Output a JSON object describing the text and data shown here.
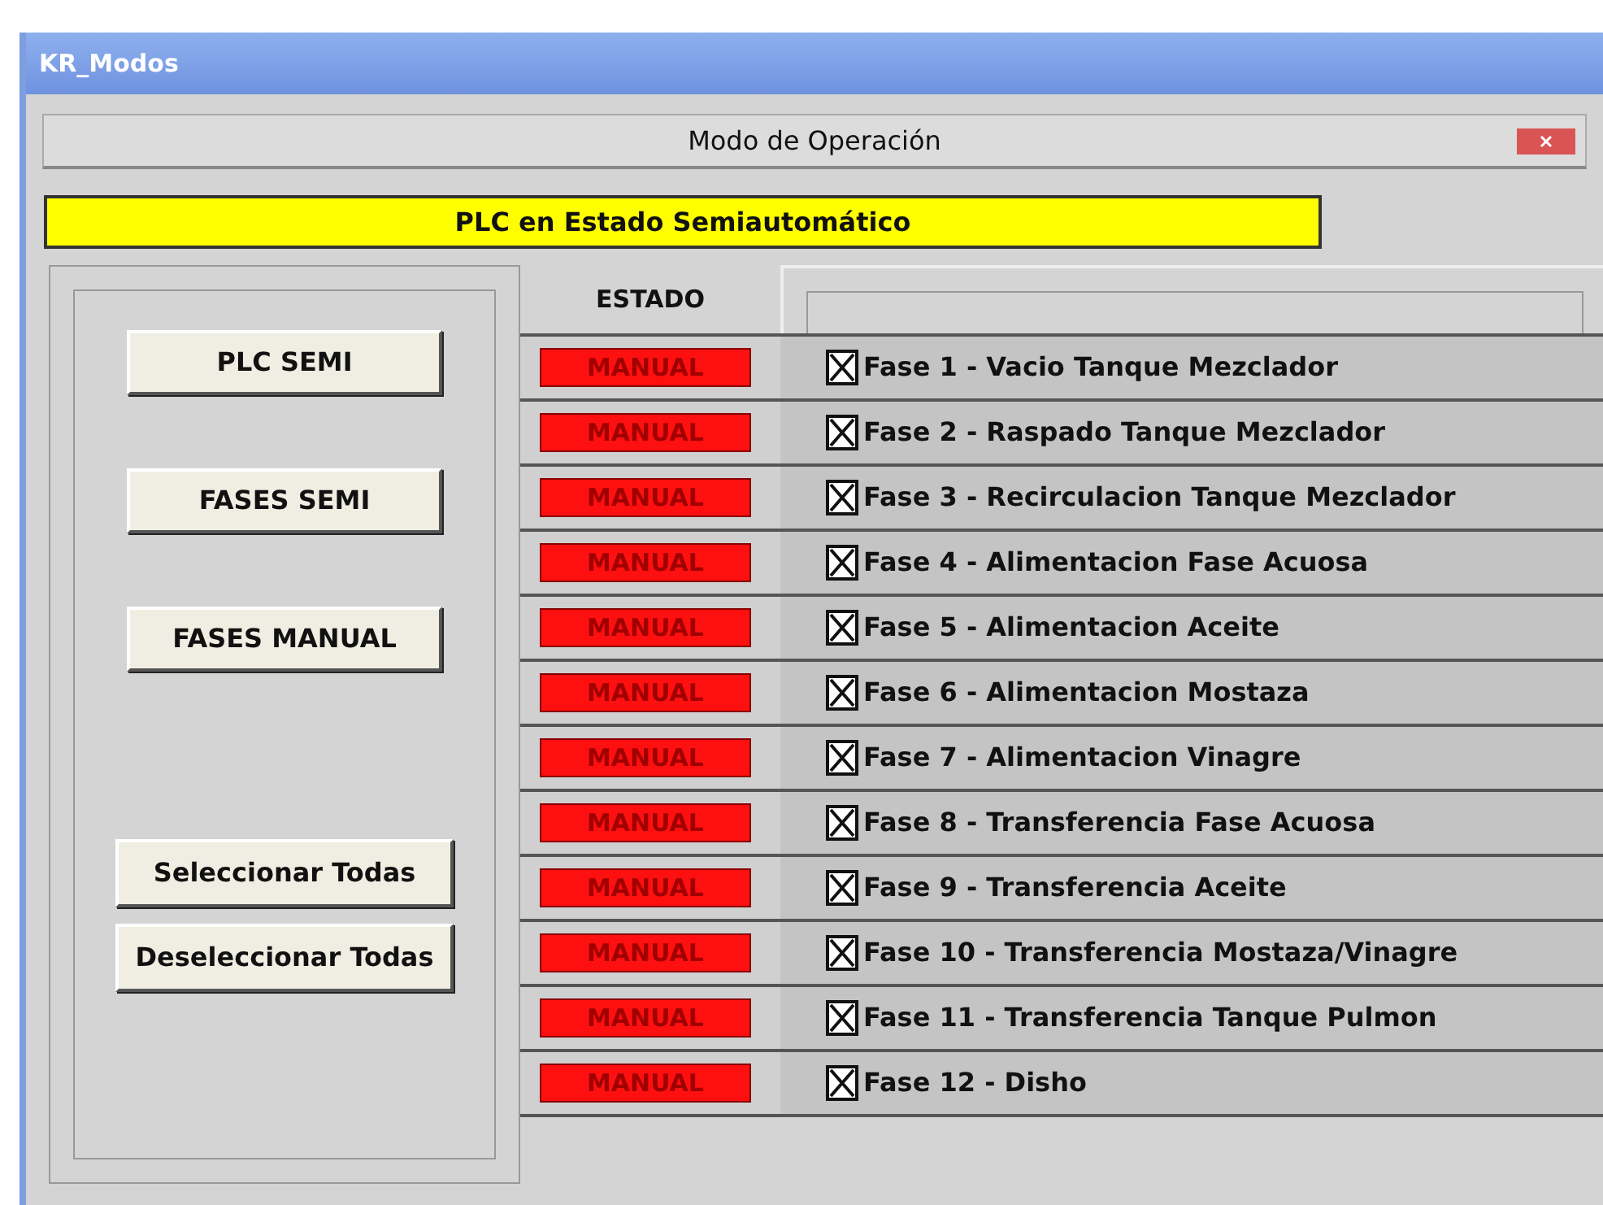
{
  "window": {
    "title": "KR_Modos"
  },
  "dialog": {
    "title": "Modo de Operación"
  },
  "status_banner": "PLC en Estado Semiautomático",
  "mode_buttons": [
    "PLC SEMI",
    "FASES SEMI",
    "FASES MANUAL"
  ],
  "selection_buttons": [
    "Seleccionar Todas",
    "Deseleccionar Todas"
  ],
  "table": {
    "status_header": "ESTADO",
    "rows": [
      {
        "status": "MANUAL",
        "checked": true,
        "phase": "Fase 1 - Vacio Tanque Mezclador"
      },
      {
        "status": "MANUAL",
        "checked": true,
        "phase": "Fase 2 - Raspado Tanque Mezclador"
      },
      {
        "status": "MANUAL",
        "checked": true,
        "phase": "Fase 3 - Recirculacion Tanque Mezclador"
      },
      {
        "status": "MANUAL",
        "checked": true,
        "phase": "Fase 4 - Alimentacion Fase Acuosa"
      },
      {
        "status": "MANUAL",
        "checked": true,
        "phase": "Fase 5 - Alimentacion Aceite"
      },
      {
        "status": "MANUAL",
        "checked": true,
        "phase": "Fase 6 - Alimentacion Mostaza"
      },
      {
        "status": "MANUAL",
        "checked": true,
        "phase": "Fase 7 - Alimentacion Vinagre"
      },
      {
        "status": "MANUAL",
        "checked": true,
        "phase": "Fase 8 - Transferencia Fase Acuosa"
      },
      {
        "status": "MANUAL",
        "checked": true,
        "phase": "Fase 9 - Transferencia Aceite"
      },
      {
        "status": "MANUAL",
        "checked": true,
        "phase": "Fase 10 - Transferencia Mostaza/Vinagre"
      },
      {
        "status": "MANUAL",
        "checked": true,
        "phase": "Fase 11 - Transferencia Tanque Pulmon"
      },
      {
        "status": "MANUAL",
        "checked": true,
        "phase": "Fase 12 - Disho"
      }
    ]
  }
}
